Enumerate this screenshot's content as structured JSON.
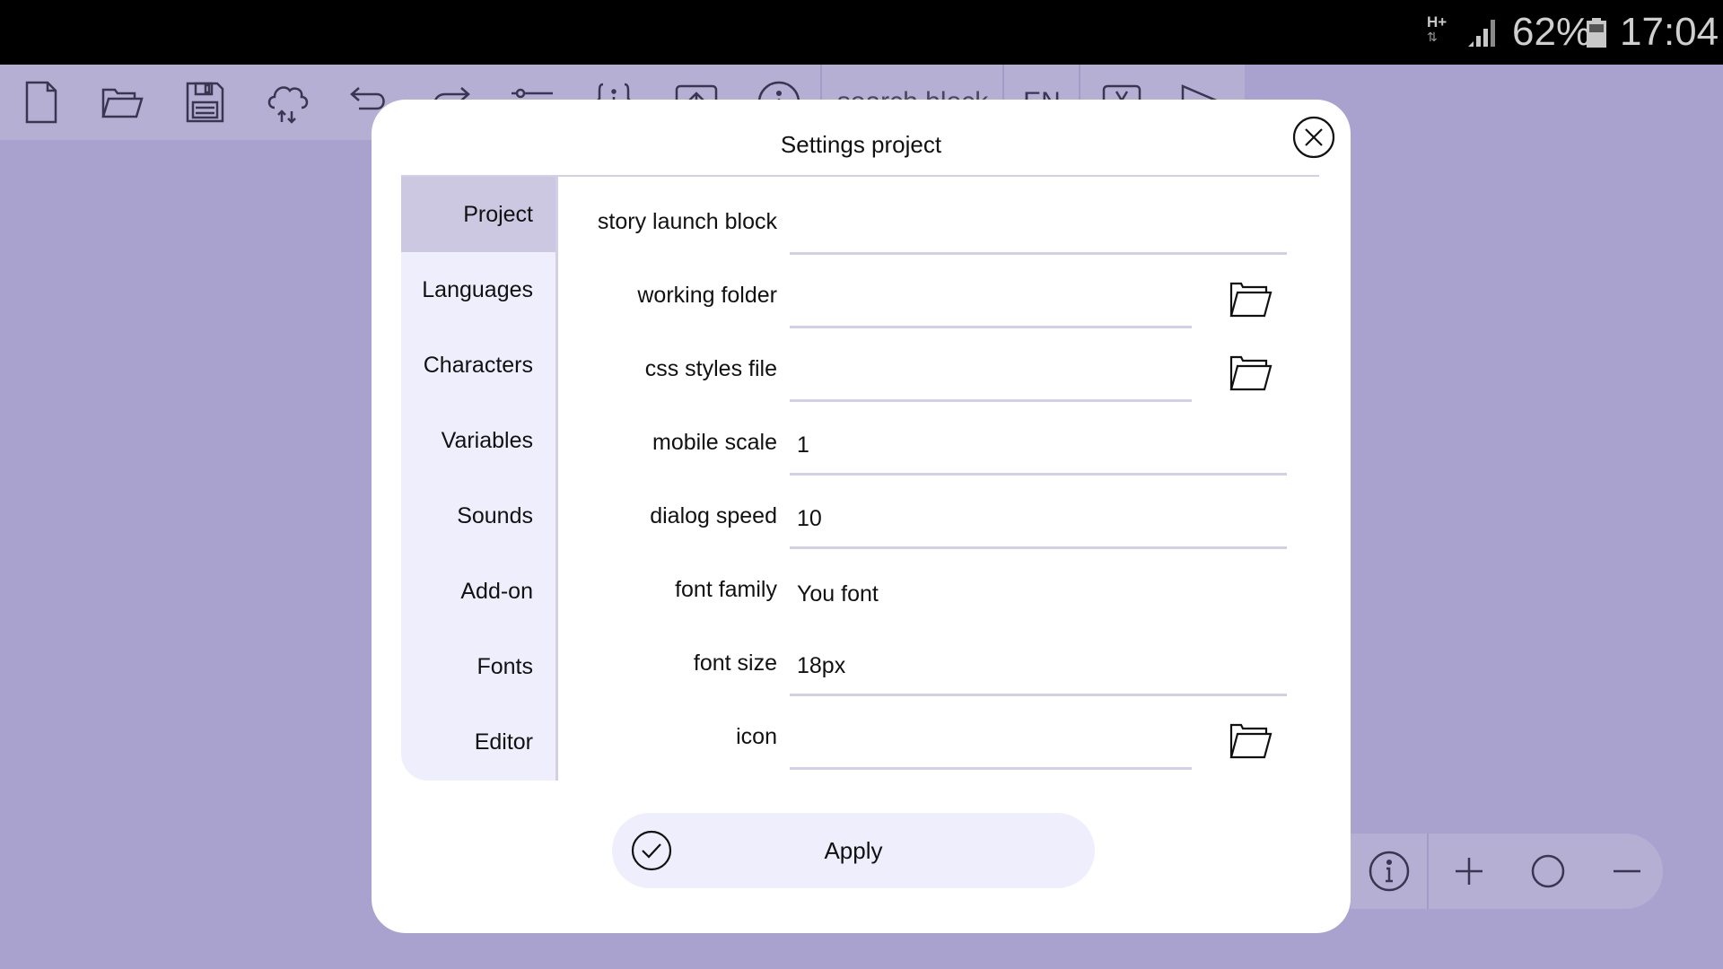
{
  "status_bar": {
    "network": "H+",
    "battery_percent": "62%",
    "time": "17:04"
  },
  "toolbar": {
    "buttons": [
      {
        "name": "new-file",
        "icon": "file-icon"
      },
      {
        "name": "open-folder",
        "icon": "folder-open-icon"
      },
      {
        "name": "save",
        "icon": "floppy-disk-icon"
      },
      {
        "name": "cloud-sync",
        "icon": "cloud-sync-icon"
      },
      {
        "name": "undo",
        "icon": "undo-icon"
      },
      {
        "name": "redo",
        "icon": "redo-icon"
      },
      {
        "name": "settings-sliders",
        "icon": "sliders-icon"
      },
      {
        "name": "variables",
        "icon": "braces-icon"
      },
      {
        "name": "export",
        "icon": "upload-box-icon"
      },
      {
        "name": "info",
        "icon": "info-icon"
      }
    ],
    "search_placeholder": "search block",
    "language": "EN",
    "variable_button_icon": "variable-x-icon",
    "play_button_icon": "play-icon"
  },
  "zoom_controls": {
    "info_icon": "info-icon",
    "zoom_in_icon": "plus-icon",
    "reset_icon": "circle-icon",
    "zoom_out_icon": "minus-icon"
  },
  "dialog": {
    "title": "Settings project",
    "close_icon": "close-circle-icon",
    "tabs": [
      {
        "label": "Project",
        "active": true
      },
      {
        "label": "Languages",
        "active": false
      },
      {
        "label": "Characters",
        "active": false
      },
      {
        "label": "Variables",
        "active": false
      },
      {
        "label": "Sounds",
        "active": false
      },
      {
        "label": "Add-on",
        "active": false
      },
      {
        "label": "Fonts",
        "active": false
      },
      {
        "label": "Editor",
        "active": false
      }
    ],
    "fields": {
      "story_launch_block": {
        "label": "story launch block",
        "value": ""
      },
      "working_folder": {
        "label": "working folder",
        "value": ""
      },
      "css_styles_file": {
        "label": "css styles file",
        "value": ""
      },
      "mobile_scale": {
        "label": "mobile scale",
        "value": "1"
      },
      "dialog_speed": {
        "label": "dialog speed",
        "value": "10"
      },
      "font_family": {
        "label": "font family",
        "value": "You font"
      },
      "font_size": {
        "label": "font size",
        "value": "18px"
      },
      "icon": {
        "label": "icon",
        "value": ""
      }
    },
    "apply_label": "Apply"
  },
  "colors": {
    "background": "#a9a2cf",
    "toolbar": "#b4afd3",
    "tab_active": "#cdc8e2",
    "tab_inactive": "#efeefc",
    "underline": "#d3cfe6"
  }
}
